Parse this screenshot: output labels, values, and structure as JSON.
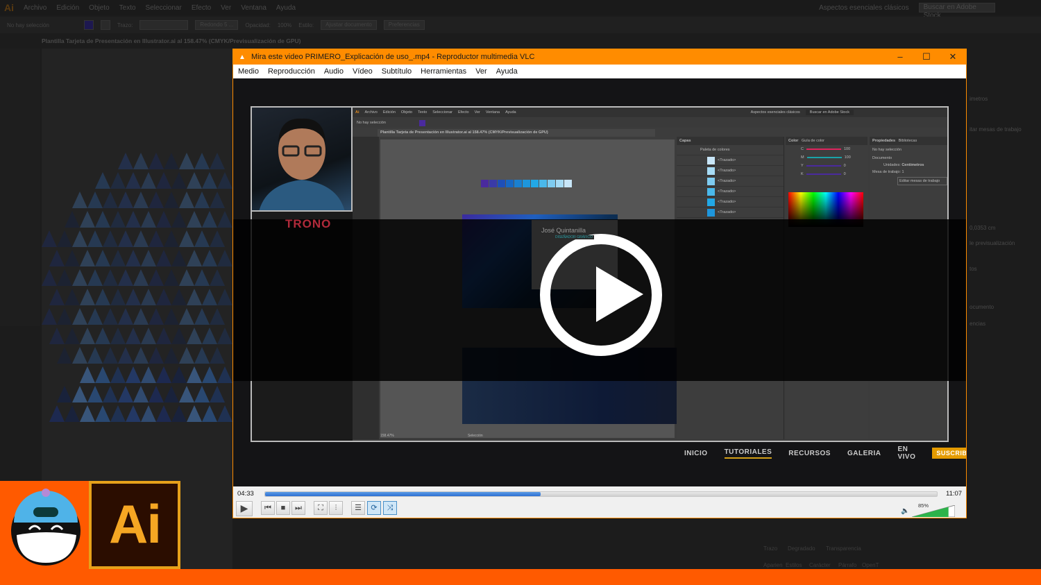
{
  "background_app": {
    "menu": [
      "Archivo",
      "Edición",
      "Objeto",
      "Texto",
      "Seleccionar",
      "Efecto",
      "Ver",
      "Ventana",
      "Ayuda"
    ],
    "logo": "Ai",
    "control_bar": {
      "selection": "No hay selección",
      "stroke_label": "Trazo:",
      "brush": "Redondo 5 ...",
      "opacity_label": "Opacidad:",
      "opacity": "100%",
      "style_label": "Estilo:",
      "adjust_button": "Ajustar documento",
      "prefs_button": "Preferencias"
    },
    "workspace": "Aspectos esenciales clásicos",
    "stock_search_placeholder": "Buscar en Adobe Stock",
    "doc_tab": "Plantilla Tarjeta de Presentación en Illustrator.ai al 158.47% (CMYK/Previsualización de GPU)",
    "right_panel": [
      "imetros",
      "itar mesas de trabajo",
      "0,0353 cm",
      "le previsualización",
      "tos",
      "ocumento",
      "encias"
    ],
    "bottom_panel": [
      "Trazo",
      "Degradado",
      "Transparencia",
      "Aparien",
      "Estilos",
      "Carácter",
      "Párrafo",
      "OpenT"
    ]
  },
  "brand": {
    "orange": "#ff5a00",
    "ai_logo": "Ai",
    "ai_gold": "#f5a623"
  },
  "vlc": {
    "title": "Mira este video PRIMERO_Explicación de uso_.mp4 - Reproductor multimedia VLC",
    "title_color": "#ff8c00",
    "menu": [
      "Medio",
      "Reproducción",
      "Audio",
      "Vídeo",
      "Subtítulo",
      "Herramientas",
      "Ver",
      "Ayuda"
    ],
    "time_current": "04:33",
    "time_total": "11:07",
    "progress_fraction": 0.41,
    "volume": "85%",
    "volume_fraction": 0.85,
    "state": "paused"
  },
  "video": {
    "channel_logo": "TRONO",
    "inner_app": {
      "menu": [
        "Archivo",
        "Edición",
        "Objeto",
        "Texto",
        "Seleccionar",
        "Efecto",
        "Ver",
        "Ventana",
        "Ayuda"
      ],
      "selection": "No hay selección",
      "doc_tab": "Plantilla Tarjeta de Presentación en Illustrator.ai al 158.47% (CMYK/Previsualización de GPU)",
      "workspace": "Aspectos esenciales clásicos",
      "search_placeholder": "Buscar en Adobe Stock",
      "swatches": [
        "#4a2a9e",
        "#3a3aa8",
        "#1e4fb8",
        "#1768c4",
        "#1a80d0",
        "#1e96dc",
        "#22a8e6",
        "#4ab8ea",
        "#7ecbf0",
        "#a6dbf5",
        "#c8e6f8"
      ],
      "card_name": "José Quintanilla",
      "card_role": "DISEÑADOR GRÁFICO",
      "layers_title": "Capas",
      "layer_group": "Paleta de colores",
      "layer_item": "<Trazado>",
      "color_tabs": [
        "Color",
        "Guía de color"
      ],
      "cmyk": [
        {
          "label": "C",
          "value": "100"
        },
        {
          "label": "M",
          "value": "100"
        },
        {
          "label": "Y",
          "value": "0"
        },
        {
          "label": "K",
          "value": "0"
        }
      ],
      "props_tabs": [
        "Propiedades",
        "Bibliotecas"
      ],
      "props": {
        "none": "No hay selección",
        "document": "Documento",
        "units_label": "Unidades:",
        "units": "Centímetros",
        "artboard_label": "Mesa de trabajo:",
        "artboard": "1",
        "edit_artboards": "Editar mesas de trabajo"
      },
      "zoom": "158.47%",
      "status": "Selección"
    },
    "site_nav": [
      "INICIO",
      "TUTORIALES",
      "RECURSOS",
      "GALERIA",
      "EN VIVO"
    ],
    "subscribe": "SUSCRIBETE"
  }
}
